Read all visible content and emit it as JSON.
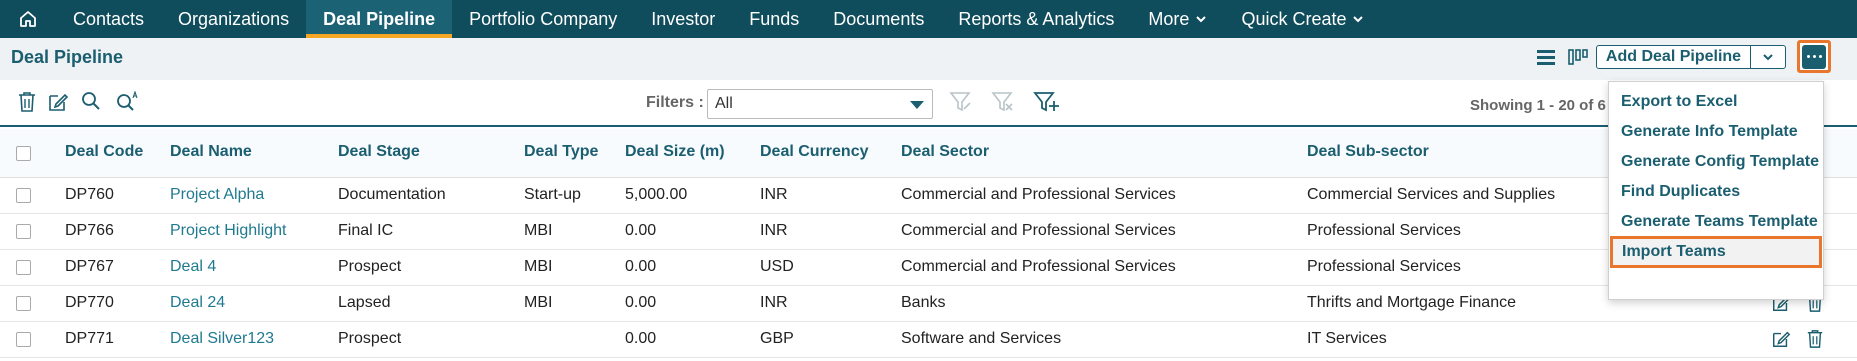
{
  "nav": {
    "items": [
      {
        "label": "Contacts",
        "active": false
      },
      {
        "label": "Organizations",
        "active": false
      },
      {
        "label": "Deal Pipeline",
        "active": true
      },
      {
        "label": "Portfolio Company",
        "active": false
      },
      {
        "label": "Investor",
        "active": false
      },
      {
        "label": "Funds",
        "active": false
      },
      {
        "label": "Documents",
        "active": false
      },
      {
        "label": "Reports & Analytics",
        "active": false
      }
    ],
    "more_label": "More",
    "quick_create_label": "Quick Create"
  },
  "header": {
    "title": "Deal Pipeline",
    "add_button_label": "Add Deal Pipeline"
  },
  "toolbar": {
    "filters_label": "Filters :",
    "filter_value": "All",
    "showing_text": "Showing 1 - 20 of 6"
  },
  "table": {
    "columns": [
      "Deal Code",
      "Deal Name",
      "Deal Stage",
      "Deal Type",
      "Deal Size (m)",
      "Deal Currency",
      "Deal Sector",
      "Deal Sub-sector"
    ],
    "rows": [
      {
        "code": "DP760",
        "name": "Project Alpha",
        "stage": "Documentation",
        "type": "Start-up",
        "size": "5,000.00",
        "currency": "INR",
        "sector": "Commercial and Professional Services",
        "subsector": "Commercial Services and Supplies"
      },
      {
        "code": "DP766",
        "name": "Project Highlight",
        "stage": "Final IC",
        "type": "MBI",
        "size": "0.00",
        "currency": "INR",
        "sector": "Commercial and Professional Services",
        "subsector": "Professional Services"
      },
      {
        "code": "DP767",
        "name": "Deal 4",
        "stage": "Prospect",
        "type": "MBI",
        "size": "0.00",
        "currency": "USD",
        "sector": "Commercial and Professional Services",
        "subsector": "Professional Services"
      },
      {
        "code": "DP770",
        "name": "Deal 24",
        "stage": "Lapsed",
        "type": "MBI",
        "size": "0.00",
        "currency": "INR",
        "sector": "Banks",
        "subsector": "Thrifts and Mortgage Finance"
      },
      {
        "code": "DP771",
        "name": "Deal Silver123",
        "stage": "Prospect",
        "type": "",
        "size": "0.00",
        "currency": "GBP",
        "sector": "Software and Services",
        "subsector": "IT Services"
      }
    ]
  },
  "menu": {
    "items": [
      {
        "label": "Export to Excel",
        "highlighted": false
      },
      {
        "label": "Generate Info Template",
        "highlighted": false
      },
      {
        "label": "Generate Config Template",
        "highlighted": false
      },
      {
        "label": "Find Duplicates",
        "highlighted": false
      },
      {
        "label": "Generate Teams Template",
        "highlighted": false
      },
      {
        "label": "Import Teams",
        "highlighted": true
      }
    ]
  },
  "colors": {
    "nav_bg": "#0f4c5c",
    "accent": "#1b5e70",
    "active_underline": "#f5a623",
    "highlight_outline": "#e8762c",
    "link": "#1f7a90"
  }
}
